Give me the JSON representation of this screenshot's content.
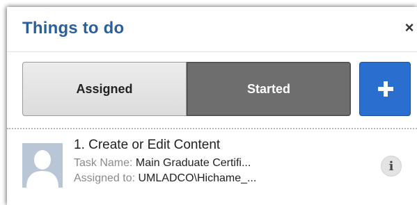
{
  "panel": {
    "title": "Things to do",
    "close_glyph": "×"
  },
  "tabs": [
    {
      "label": "Assigned",
      "selected": false
    },
    {
      "label": "Started",
      "selected": true
    }
  ],
  "add_button": {
    "icon": "plus-icon"
  },
  "tasks": [
    {
      "title": "1. Create or Edit Content",
      "task_name_label": "Task Name:",
      "task_name_value": "Main Graduate Certifi...",
      "assigned_label": "Assigned to:",
      "assigned_value": "UMLADCO\\Hichame_...",
      "avatar_icon": "user-avatar-icon",
      "info_glyph": "i"
    }
  ],
  "colors": {
    "title": "#2a5f9e",
    "add_button": "#2a6fd0",
    "selected_tab": "#6e6e6e",
    "avatar_bg": "#b8c6d6"
  }
}
